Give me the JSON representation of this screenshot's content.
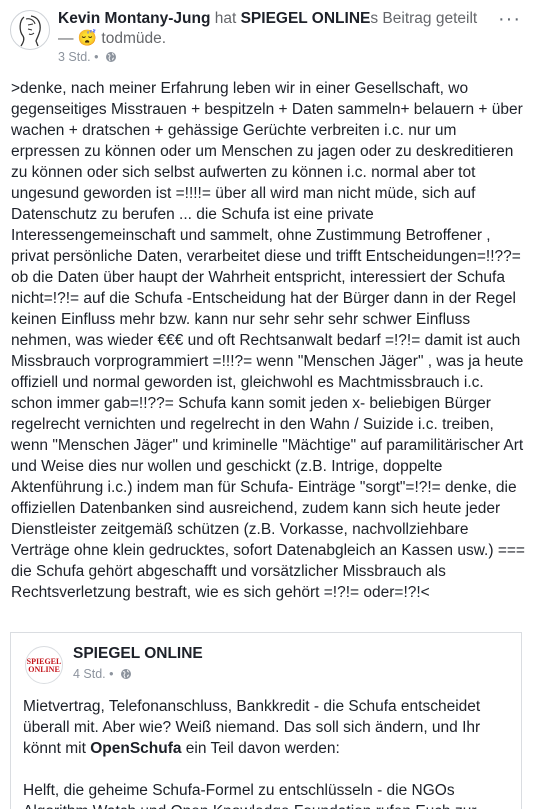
{
  "post": {
    "author": "Kevin Montany-Jung",
    "shared_prefix": " hat ",
    "page_name": "SPIEGEL ONLINE",
    "shared_suffix": "s Beitrag geteilt",
    "feeling_prefix": "— ",
    "feeling_emoji": "😴",
    "feeling_text": " todmüde.",
    "time": "3 Std.",
    "dot": "•",
    "more": "···",
    "body": ">denke, nach meiner Erfahrung leben wir in einer Gesellschaft, wo gegenseitiges Misstrauen + bespitzeln + Daten sammeln+ belauern + über wachen + dratschen + gehässige Gerüchte verbreiten i.c. nur um erpressen zu können oder um Menschen zu jagen oder zu deskreditieren zu können oder sich selbst aufwerten zu können i.c. normal aber tot ungesund geworden ist =!!!!= über all wird man nicht müde, sich auf Datenschutz zu berufen ... die Schufa ist eine private Interessengemeinschaft  und sammelt, ohne Zustimmung Betroffener , privat persönliche Daten, verarbeitet diese und trifft Entscheidungen=!!??= ob die Daten über haupt der Wahrheit entspricht, interessiert der Schufa nicht=!?!=  auf die Schufa -Entscheidung hat der Bürger dann in der Regel keinen Einfluss mehr bzw. kann nur sehr sehr sehr schwer Einfluss nehmen, was wieder €€€ und oft Rechtsanwalt bedarf =!?!= damit ist auch Missbrauch vorprogrammiert =!!!?= wenn \"Menschen Jäger\" , was ja heute offiziell und normal geworden ist, gleichwohl es Machtmissbrauch i.c. schon immer gab=!!??= Schufa kann somit jeden x- beliebigen Bürger regelrecht vernichten und regelrecht in den Wahn / Suizide i.c. treiben, wenn \"Menschen Jäger\" und kriminelle \"Mächtige\" auf paramilitärischer Art und Weise dies nur wollen und geschickt (z.B. Intrige, doppelte Aktenführung i.c.) indem man für Schufa- Einträge \"sorgt\"=!?!= denke, die offiziellen Datenbanken sind ausreichend, zudem kann sich heute jeder Dienstleister zeitgemäß schützen (z.B. Vorkasse, nachvollziehbare Verträge ohne klein gedrucktes, sofort Datenabgleich an Kassen usw.) === die Schufa gehört abgeschafft und vorsätzlicher Missbrauch als Rechtsverletzung bestraft, wie es sich gehört =!?!= oder=!?!<"
  },
  "shared_post": {
    "logo_line1": "SPIEGEL",
    "logo_line2": "ONLINE",
    "name": "SPIEGEL ONLINE",
    "time": "4 Std.",
    "dot": "•",
    "para1": "Mietvertrag, Telefonanschluss, Bankkredit - die Schufa entscheidet überall mit. Aber wie? Weiß niemand. Das soll sich ändern, und Ihr könnt mit ",
    "para1_bold": "OpenSchufa",
    "para1_end": " ein Teil davon werden:",
    "para2": "Helft, die geheime Schufa-Formel zu entschlüsseln - die NGOs Algorithm Watch und Open Knowledge Foundation rufen Euch zur"
  },
  "colors": {
    "text": "#1d2129",
    "muted": "#65676b",
    "meta": "#8d949e",
    "border": "#dadde1",
    "spiegel_red": "#c4151c"
  }
}
